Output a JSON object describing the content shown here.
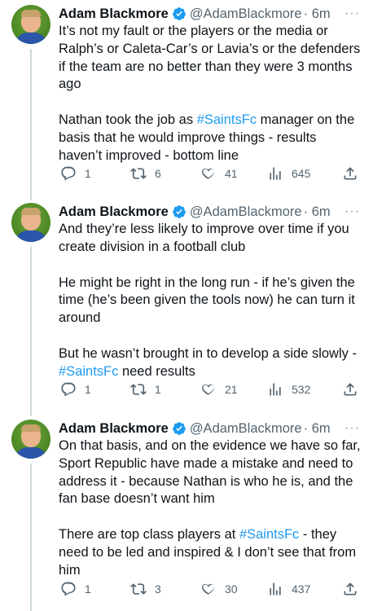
{
  "tweets": [
    {
      "name": "Adam Blackmore",
      "handle": "@AdamBlackmore",
      "time": "· 6m",
      "paragraphs": [
        [
          "It’s not my fault or the players or the media or Ralph’s or Caleta-Car’s or Lavia’s or the defenders if the team are no better than they were 3 months ago"
        ],
        [
          "Nathan took the job as ",
          "#SaintsFc",
          " manager on the basis that he would improve things - results haven’t improved - bottom line"
        ]
      ],
      "replies": "1",
      "retweets": "6",
      "likes": "41",
      "views": "645"
    },
    {
      "name": "Adam Blackmore",
      "handle": "@AdamBlackmore",
      "time": "· 6m",
      "paragraphs": [
        [
          "And they’re less likely to improve over time if you create division in a football club"
        ],
        [
          "He might be right in the long run - if he’s given the time (he’s been given the tools now) he can turn it around"
        ],
        [
          "But he wasn’t brought in to develop a side slowly - ",
          "#SaintsFc",
          " need results"
        ]
      ],
      "replies": "1",
      "retweets": "1",
      "likes": "21",
      "views": "532"
    },
    {
      "name": "Adam Blackmore",
      "handle": "@AdamBlackmore",
      "time": "· 6m",
      "paragraphs": [
        [
          "On that basis, and on the evidence we have so far, Sport Republic have made a mistake and need to address it - because Nathan is who he is, and the fan base doesn’t want him"
        ],
        [
          "There are top class players at ",
          "#SaintsFc",
          " - they need to be led and inspired & I don’t see that from him"
        ]
      ],
      "replies": "1",
      "retweets": "3",
      "likes": "30",
      "views": "437"
    }
  ],
  "more_label": "···",
  "colors": {
    "text": "#0f1419",
    "secondary": "#536471",
    "hashtag": "#1d9bf0",
    "verified": "#1d9bf0",
    "thread_line": "#cfd9de"
  },
  "icons": [
    "reply-icon",
    "retweet-icon",
    "like-icon",
    "views-icon",
    "share-icon",
    "verified-icon",
    "more-icon"
  ]
}
